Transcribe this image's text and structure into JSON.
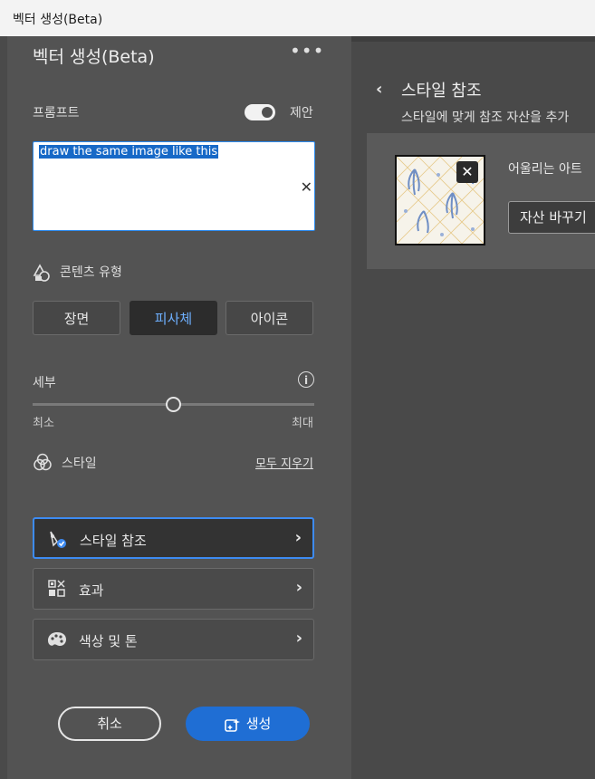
{
  "window": {
    "title": "벡터 생성(Beta)"
  },
  "panel": {
    "title": "벡터 생성(Beta)",
    "more_icon": "ellipsis-icon"
  },
  "prompt": {
    "label": "프롬프트",
    "toggle_on": true,
    "toggle_label": "제안",
    "value": "draw the same image like this"
  },
  "content_type": {
    "label": "콘텐츠 유형",
    "options": [
      "장면",
      "피사체",
      "아이콘"
    ],
    "selected": "피사체"
  },
  "detail": {
    "label": "세부",
    "min_label": "최소",
    "max_label": "최대",
    "level": 0.5
  },
  "style": {
    "label": "스타일",
    "clear_all": "모두 지우기",
    "items": [
      {
        "label": "스타일 참조",
        "icon": "style-reference-icon",
        "active": true
      },
      {
        "label": "효과",
        "icon": "effects-icon",
        "active": false
      },
      {
        "label": "색상 및 톤",
        "icon": "palette-icon",
        "active": false
      }
    ]
  },
  "actions": {
    "cancel": "취소",
    "generate": "생성"
  },
  "style_reference_panel": {
    "title": "스타일 참조",
    "subtitle": "스타일에 맞게 참조 자산을 추가",
    "card_text": "어울리는 아트",
    "replace_button": "자산 바꾸기"
  },
  "colors": {
    "accent": "#1f6ed4",
    "selected_text": "#6eb0ff",
    "panel_bg": "#535353"
  }
}
